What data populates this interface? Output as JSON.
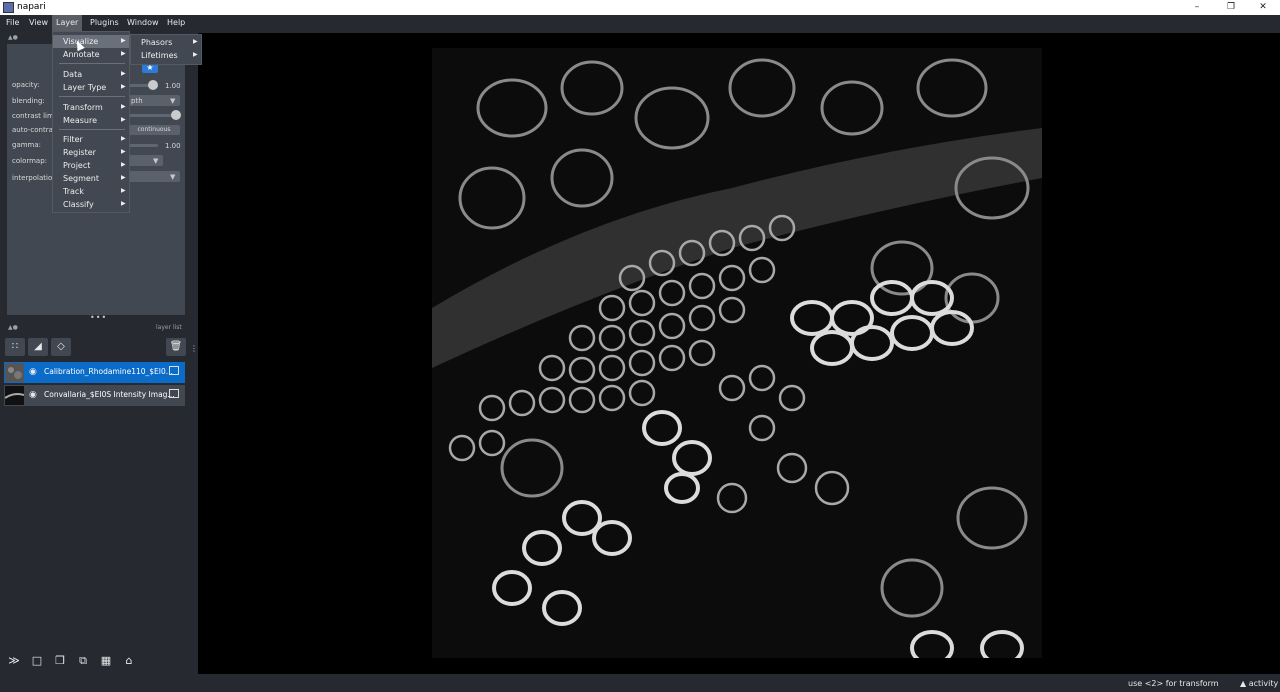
{
  "window": {
    "title": "napari",
    "icon": "napari-icon",
    "controls": [
      "minimize-icon",
      "restore-icon",
      "close-icon"
    ]
  },
  "menubar": {
    "items": [
      "File",
      "View",
      "Layer",
      "Plugins",
      "Window",
      "Help"
    ],
    "active": "Layer"
  },
  "layer_menu": {
    "items": [
      {
        "label": "Visualize",
        "has_sub": true
      },
      {
        "label": "Annotate",
        "has_sub": true
      },
      {
        "label": "Data",
        "has_sub": true
      },
      {
        "label": "Layer Type",
        "has_sub": true
      },
      {
        "label": "Transform",
        "has_sub": true
      },
      {
        "label": "Measure",
        "has_sub": true
      },
      {
        "label": "Filter",
        "has_sub": true
      },
      {
        "label": "Register",
        "has_sub": true
      },
      {
        "label": "Project",
        "has_sub": true
      },
      {
        "label": "Segment",
        "has_sub": true
      },
      {
        "label": "Track",
        "has_sub": true
      },
      {
        "label": "Classify",
        "has_sub": true
      }
    ]
  },
  "visualize_submenu": {
    "items": [
      {
        "label": "Phasors"
      },
      {
        "label": "Lifetimes"
      }
    ]
  },
  "layer_controls": {
    "opacity_label": "opacity:",
    "opacity_value": "1.00",
    "blending_label": "blending:",
    "blending_value": "pth",
    "contrast_label": "contrast limi",
    "autocontrast_label": "auto-contras",
    "autocontrast_button": "continuous",
    "gamma_label": "gamma:",
    "gamma_value": "1.00",
    "colormap_label": "colormap:",
    "interpolation_label": "interpolation"
  },
  "layer_list": {
    "header": "layer list",
    "layers": [
      {
        "name": "Calibration_Rhodamine110_$EI0...",
        "selected": true,
        "visible": true
      },
      {
        "name": "Convallaria_$EI0S Intensity Imag...",
        "selected": false,
        "visible": true
      }
    ]
  },
  "status": {
    "hint": "use <2> for transform",
    "activity": "activity"
  },
  "colors": {
    "accent": "#0b6bc9",
    "panel": "#414851",
    "background": "#262930",
    "canvas": "#000000"
  }
}
